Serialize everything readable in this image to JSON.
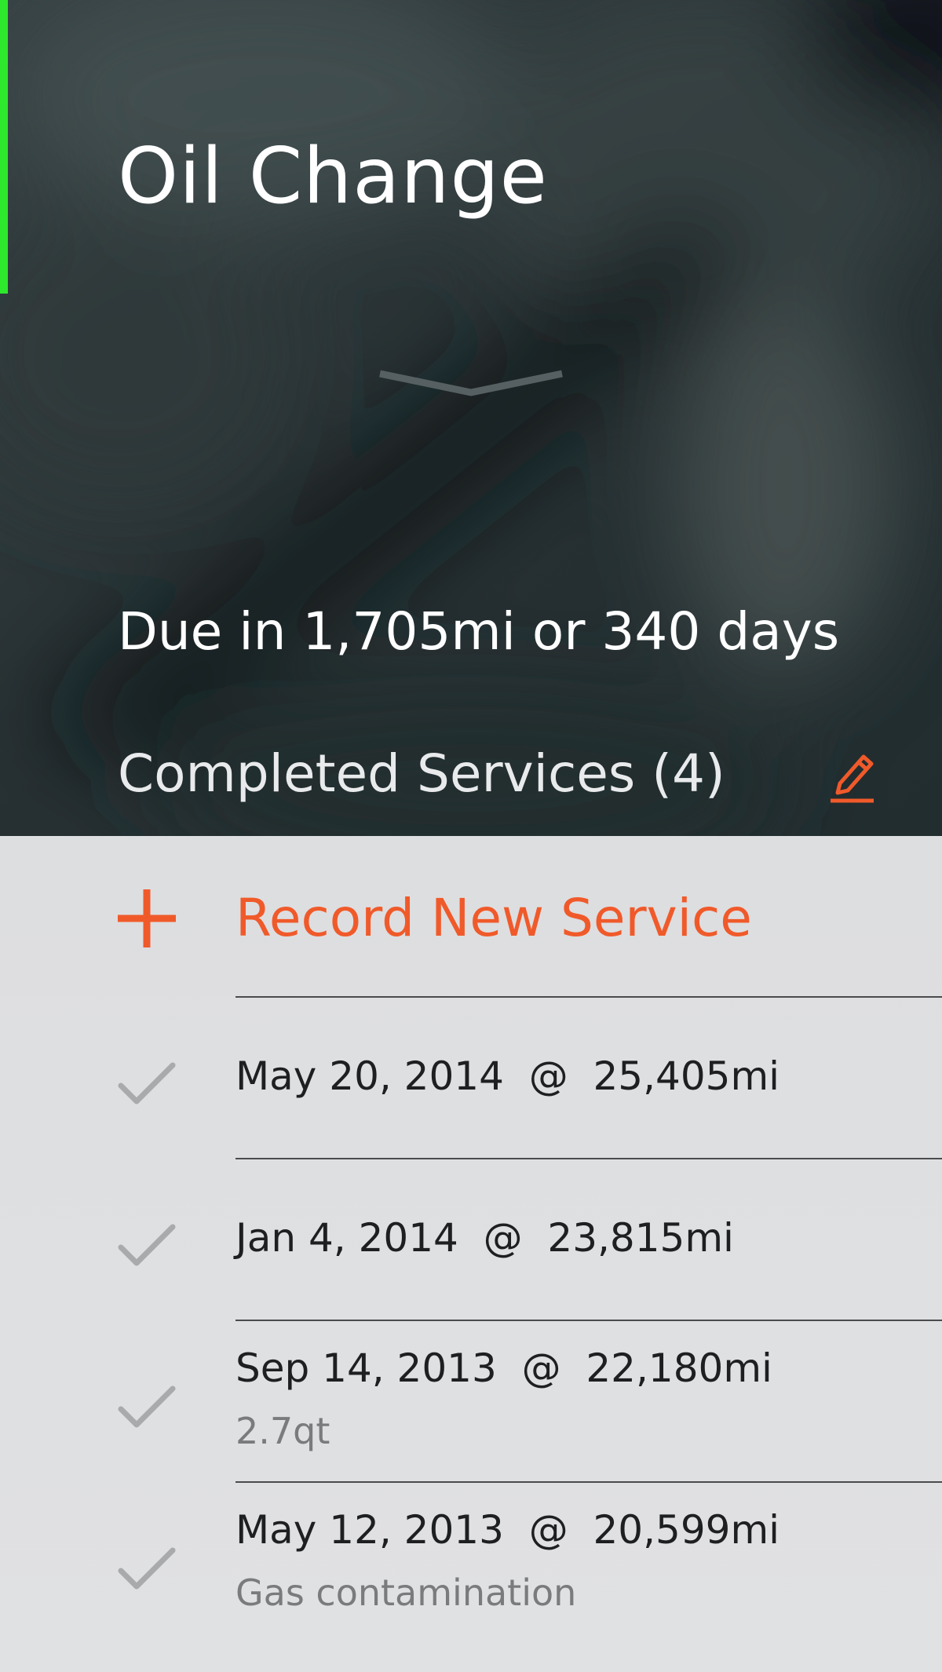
{
  "header": {
    "title": "Oil Change",
    "due_text": "Due in 1,705mi or 340 days",
    "completed_label": "Completed Services (4)",
    "chevron_icon": "chevron-down-icon",
    "edit_icon": "pencil-icon"
  },
  "actions": {
    "record_label": "Record New Service",
    "record_icon": "plus-icon"
  },
  "services": [
    {
      "main": "May 20, 2014  @  25,405mi",
      "note": ""
    },
    {
      "main": "Jan 4, 2014  @  23,815mi",
      "note": ""
    },
    {
      "main": "Sep 14, 2013  @  22,180mi",
      "note": "2.7qt"
    },
    {
      "main": "May 12, 2013  @  20,599mi",
      "note": "Gas contamination"
    }
  ],
  "colors": {
    "accent": "#f05a2a",
    "hero_text": "#ffffff",
    "list_background": "#dfe0e2",
    "check": "#a9aaac",
    "left_marker": "#2ee82e"
  }
}
